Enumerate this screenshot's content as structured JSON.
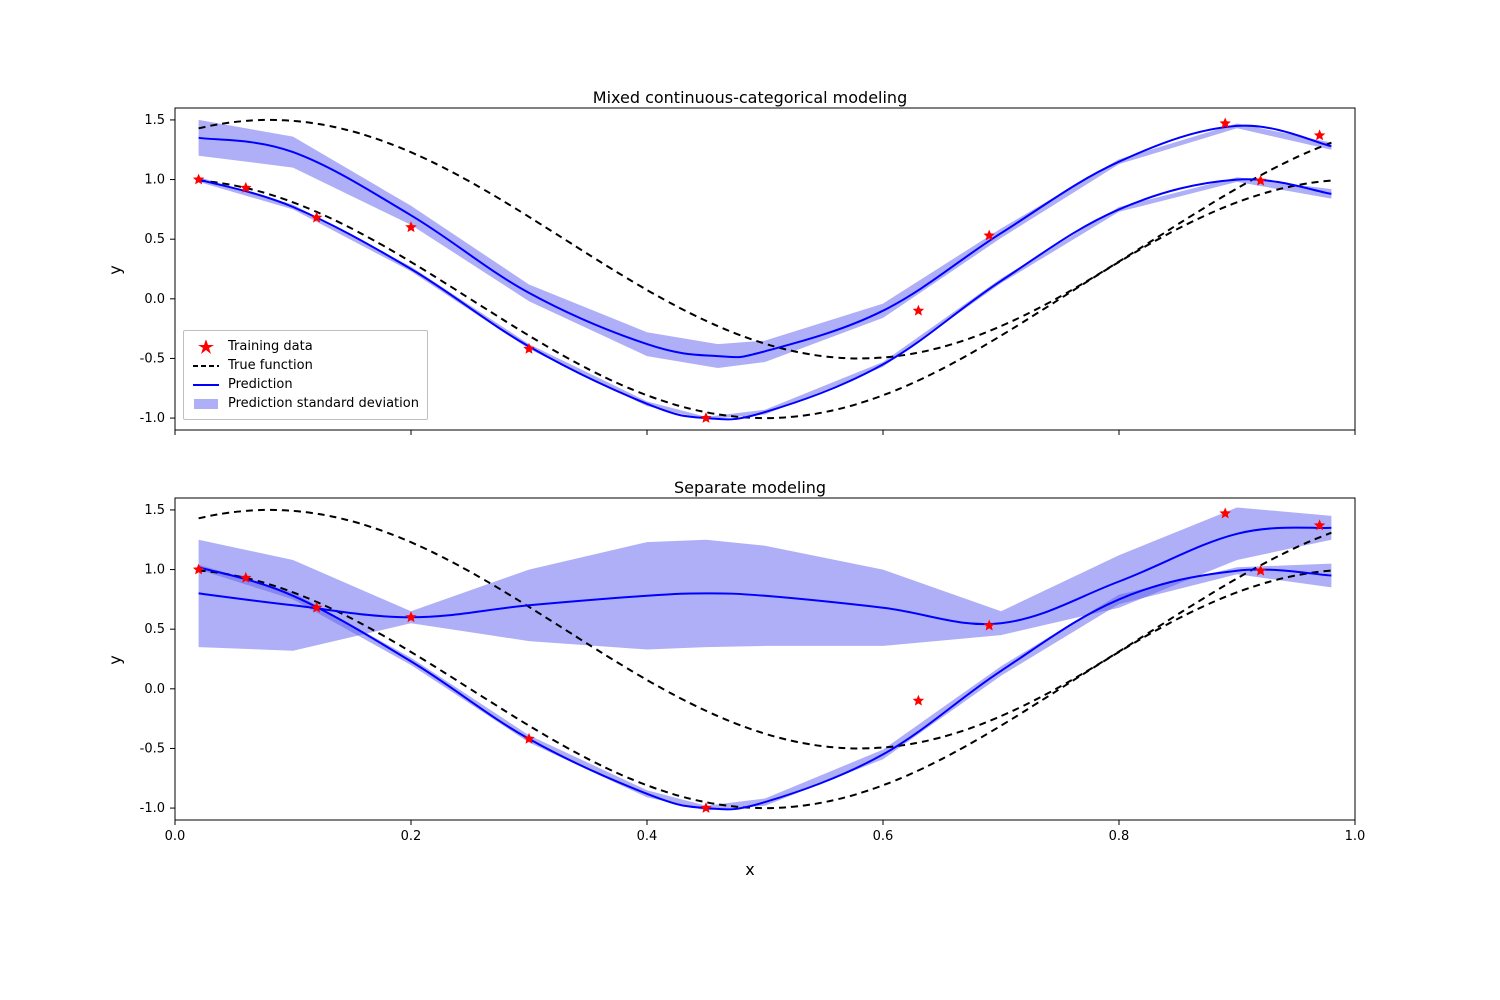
{
  "chart_data": [
    {
      "type": "line",
      "title": "Mixed continuous-categorical modeling",
      "xlabel": "x",
      "ylabel": "y",
      "xlim": [
        0.0,
        1.0
      ],
      "ylim": [
        -1.1,
        1.6
      ],
      "xticks": [
        0.0,
        0.2,
        0.4,
        0.6,
        0.8,
        1.0
      ],
      "yticks": [
        -1.0,
        -0.5,
        0.0,
        0.5,
        1.0,
        1.5
      ],
      "legend": [
        "Training data",
        "True function",
        "Prediction",
        "Prediction standard deviation"
      ],
      "training_points": [
        {
          "x": 0.02,
          "y": 1.0
        },
        {
          "x": 0.06,
          "y": 0.93
        },
        {
          "x": 0.12,
          "y": 0.68
        },
        {
          "x": 0.2,
          "y": 0.6
        },
        {
          "x": 0.3,
          "y": -0.42
        },
        {
          "x": 0.45,
          "y": -1.0
        },
        {
          "x": 0.63,
          "y": -0.1
        },
        {
          "x": 0.69,
          "y": 0.53
        },
        {
          "x": 0.89,
          "y": 1.47
        },
        {
          "x": 0.92,
          "y": 0.99
        },
        {
          "x": 0.97,
          "y": 1.37
        }
      ],
      "true_function": {
        "curve1": {
          "offset": 0.0,
          "amplitude": 1.0,
          "phase": 0.0
        },
        "curve2": {
          "offset": 0.5,
          "amplitude": 1.0,
          "phase": -0.08
        }
      },
      "curve1_prediction": {
        "x": [
          0.02,
          0.1,
          0.2,
          0.3,
          0.4,
          0.45,
          0.5,
          0.6,
          0.7,
          0.8,
          0.9,
          0.98
        ],
        "mean": [
          1.0,
          0.77,
          0.25,
          -0.4,
          -0.88,
          -1.0,
          -0.95,
          -0.55,
          0.15,
          0.75,
          1.0,
          0.88
        ],
        "std": [
          0.02,
          0.02,
          0.02,
          0.02,
          0.02,
          0.01,
          0.02,
          0.02,
          0.02,
          0.02,
          0.02,
          0.04
        ]
      },
      "curve2_prediction": {
        "x": [
          0.02,
          0.1,
          0.2,
          0.3,
          0.4,
          0.46,
          0.5,
          0.6,
          0.7,
          0.8,
          0.9,
          0.98
        ],
        "mean": [
          1.35,
          1.23,
          0.7,
          0.05,
          -0.38,
          -0.48,
          -0.44,
          -0.1,
          0.55,
          1.15,
          1.45,
          1.28
        ],
        "std": [
          0.15,
          0.13,
          0.08,
          0.07,
          0.1,
          0.1,
          0.09,
          0.06,
          0.04,
          0.02,
          0.02,
          0.03
        ]
      }
    },
    {
      "type": "line",
      "title": "Separate modeling",
      "xlabel": "x",
      "ylabel": "y",
      "xlim": [
        0.0,
        1.0
      ],
      "ylim": [
        -1.1,
        1.6
      ],
      "xticks": [
        0.0,
        0.2,
        0.4,
        0.6,
        0.8,
        1.0
      ],
      "yticks": [
        -1.0,
        -0.5,
        0.0,
        0.5,
        1.0,
        1.5
      ],
      "training_points": [
        {
          "x": 0.02,
          "y": 1.0
        },
        {
          "x": 0.06,
          "y": 0.93
        },
        {
          "x": 0.12,
          "y": 0.68
        },
        {
          "x": 0.2,
          "y": 0.6
        },
        {
          "x": 0.3,
          "y": -0.42
        },
        {
          "x": 0.45,
          "y": -1.0
        },
        {
          "x": 0.63,
          "y": -0.1
        },
        {
          "x": 0.69,
          "y": 0.53
        },
        {
          "x": 0.89,
          "y": 1.47
        },
        {
          "x": 0.92,
          "y": 0.99
        },
        {
          "x": 0.97,
          "y": 1.37
        }
      ],
      "true_function": {
        "curve1": {
          "offset": 0.0,
          "amplitude": 1.0,
          "phase": 0.0
        },
        "curve2": {
          "offset": 0.5,
          "amplitude": 1.0,
          "phase": -0.08
        }
      },
      "curve1_prediction": {
        "x": [
          0.02,
          0.1,
          0.2,
          0.3,
          0.4,
          0.45,
          0.5,
          0.6,
          0.7,
          0.8,
          0.9,
          0.98
        ],
        "mean": [
          1.02,
          0.78,
          0.23,
          -0.42,
          -0.88,
          -1.0,
          -0.95,
          -0.55,
          0.15,
          0.75,
          0.99,
          0.95
        ],
        "std": [
          0.02,
          0.03,
          0.03,
          0.03,
          0.03,
          0.02,
          0.03,
          0.04,
          0.04,
          0.04,
          0.03,
          0.1
        ]
      },
      "curve2_prediction": {
        "x": [
          0.02,
          0.1,
          0.2,
          0.3,
          0.4,
          0.45,
          0.5,
          0.6,
          0.7,
          0.8,
          0.9,
          0.98
        ],
        "mean": [
          0.8,
          0.7,
          0.6,
          0.7,
          0.78,
          0.8,
          0.78,
          0.68,
          0.55,
          0.9,
          1.3,
          1.35
        ],
        "std": [
          0.45,
          0.38,
          0.05,
          0.3,
          0.45,
          0.45,
          0.42,
          0.32,
          0.1,
          0.22,
          0.22,
          0.1
        ]
      }
    }
  ],
  "colors": {
    "prediction": "#0000ff",
    "band": "#6060f0",
    "band_opacity": 0.5,
    "true_line": "#000000",
    "marker": "#ff0000",
    "axis": "#000000"
  }
}
